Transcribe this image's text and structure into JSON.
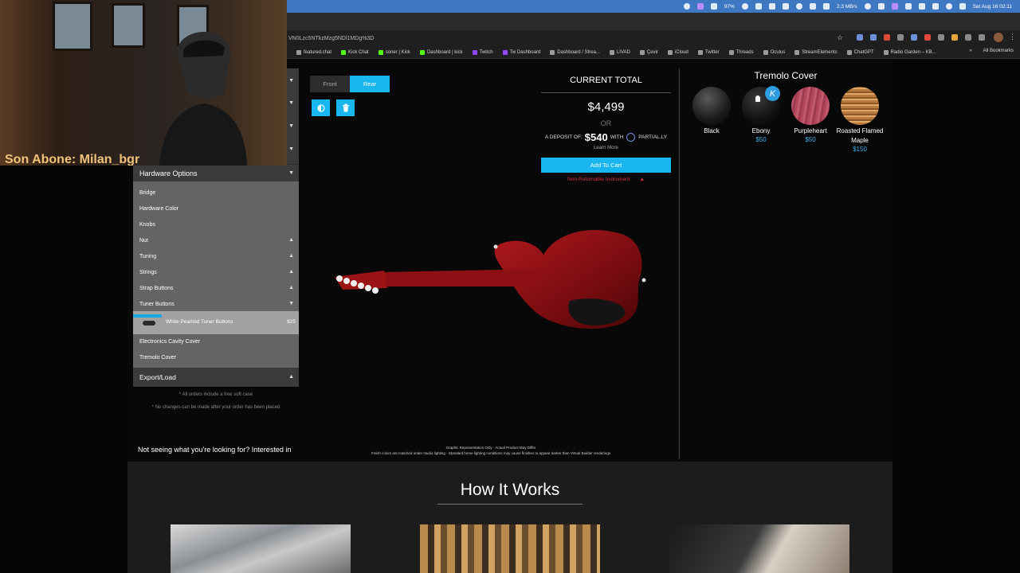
{
  "menubar": {
    "battery": "97%",
    "network": "2.3 MB/s",
    "clock": "Sat Aug 16  02:11"
  },
  "browser": {
    "url": "VN0Lzc5NTkzMzg5NDl1MDg%3D",
    "bookmarks": [
      "featured.chat",
      "Kick Chat",
      "soner | Kick",
      "Dashboard | kick",
      "Twitch",
      "Tw Dashboard",
      "Dashboard / Strea...",
      "LIVAD",
      "Çevir",
      "iCloud",
      "Twitter",
      "Threads",
      "Oculus",
      "StreamElements",
      "ChatGPT",
      "Radio Garden – KB..."
    ],
    "all_bookmarks": "All Bookmarks"
  },
  "sidebar": {
    "section_title": "Hardware Options",
    "items": [
      {
        "label": "Bridge",
        "chevron": ""
      },
      {
        "label": "Hardware Color",
        "chevron": ""
      },
      {
        "label": "Knobs",
        "chevron": ""
      },
      {
        "label": "Nut",
        "chevron": "▲"
      },
      {
        "label": "Tuning",
        "chevron": "▲"
      },
      {
        "label": "Strings",
        "chevron": "▲"
      },
      {
        "label": "Strap Buttons",
        "chevron": "▲"
      },
      {
        "label": "Tuner Buttons",
        "chevron": "▼"
      }
    ],
    "selected_option": {
      "label": "White Pearloid Tuner Buttons",
      "price": "$25"
    },
    "items_after": [
      "Electronics Cavity Cover",
      "Tremolo Cover"
    ],
    "export_title": "Export/Load",
    "note1": "* All orders include a free soft case",
    "note2": "* No changes can be made after your order has been placed",
    "footer": "Not seeing what you're looking for? Interested in"
  },
  "viewer": {
    "front_label": "Front",
    "rear_label": "Rear",
    "disclaimer1": "Graphic Representation Only · Actual Product May Differ",
    "disclaimer2": "Finish colors are matched under studio lighting - Standard home lighting conditions may cause finishes to appear darker than Virtual Builder renderings"
  },
  "total": {
    "title": "CURRENT TOTAL",
    "price": "$4,499",
    "or": "OR",
    "deposit_prefix": "A DEPOSIT OF:",
    "deposit_amount": "$540",
    "deposit_with": "WITH",
    "partially": "PARTIAL.LY",
    "learn_more": "Learn More",
    "add_to_cart": "Add To Cart",
    "non_returnable": "Non-Returnable Instrument",
    "non_returnable_arrow": "▲"
  },
  "tremolo": {
    "title": "Tremolo Cover",
    "options": [
      {
        "name": "Black",
        "price": ""
      },
      {
        "name": "Ebony",
        "price": "$50"
      },
      {
        "name": "Purpleheart",
        "price": "$50"
      },
      {
        "name": "Roasted Flamed Maple",
        "price": "$150"
      }
    ]
  },
  "how": {
    "title": "How It Works"
  },
  "webcam": {
    "name": "Son Abone: Milan_bgr"
  },
  "colors": {
    "accent": "#19b6ef",
    "warning": "#d8323a",
    "body": "#8a0f12"
  }
}
